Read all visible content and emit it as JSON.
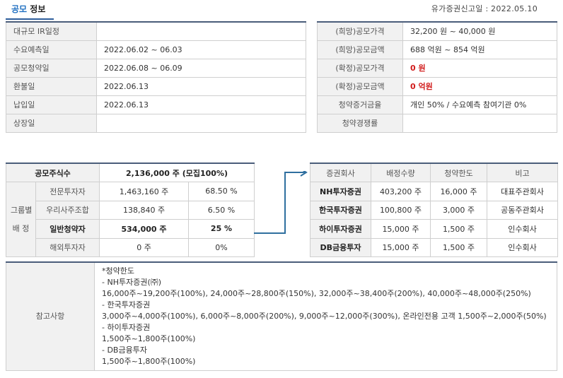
{
  "header": {
    "title_highlight": "공모",
    "title_rest": "정보",
    "report_date_label": "유가증권신고일 :",
    "report_date": "2022.05.10"
  },
  "schedule": [
    {
      "label": "대규모 IR일정",
      "value": ""
    },
    {
      "label": "수요예측일",
      "value": "2022.06.02 ~ 06.03"
    },
    {
      "label": "공모청약일",
      "value": "2022.06.08 ~ 06.09"
    },
    {
      "label": "환불일",
      "value": "2022.06.13"
    },
    {
      "label": "납입일",
      "value": "2022.06.13"
    },
    {
      "label": "상장일",
      "value": ""
    }
  ],
  "pricing": [
    {
      "label": "(희망)공모가격",
      "value": "32,200 원 ~ 40,000 원",
      "highlight": false
    },
    {
      "label": "(희망)공모금액",
      "value": "688 억원  ~ 854 억원",
      "highlight": false
    },
    {
      "label": "(확정)공모가격",
      "value": "0 원",
      "highlight": true
    },
    {
      "label": "(확정)공모금액",
      "value": "0 억원",
      "highlight": true
    },
    {
      "label": "청약증거금율",
      "value": "개인 50% / 수요예측 참여기관 0%",
      "highlight": false
    },
    {
      "label": "청약경쟁률",
      "value": "",
      "highlight": false
    }
  ],
  "allocation": {
    "total_label": "공모주식수",
    "total_value": "2,136,000 주 (모집100%)",
    "group_label_1": "그룹별",
    "group_label_2": "배 정",
    "rows": [
      {
        "label": "전문투자자",
        "shares": "1,463,160 주",
        "pct": "68.50 %",
        "bold": false
      },
      {
        "label": "우리사주조합",
        "shares": "138,840 주",
        "pct": "6.50 %",
        "bold": false
      },
      {
        "label": "일반청약자",
        "shares": "534,000 주",
        "pct": "25 %",
        "bold": true
      },
      {
        "label": "해외투자자",
        "shares": "0 주",
        "pct": "0%",
        "bold": false
      }
    ]
  },
  "brokers": {
    "headers": [
      "증권회사",
      "배정수량",
      "청약한도",
      "비고"
    ],
    "rows": [
      {
        "name": "NH투자증권",
        "qty": "403,200 주",
        "limit": "16,000 주",
        "note": "대표주관회사"
      },
      {
        "name": "한국투자증권",
        "qty": "100,800 주",
        "limit": "3,000 주",
        "note": "공동주관회사"
      },
      {
        "name": "하이투자증권",
        "qty": "15,000 주",
        "limit": "1,500 주",
        "note": "인수회사"
      },
      {
        "name": "DB금융투자",
        "qty": "15,000 주",
        "limit": "1,500 주",
        "note": "인수회사"
      }
    ]
  },
  "reference": {
    "label": "참고사항",
    "lines": [
      "*청약한도",
      "- NH투자증권(㈜)",
      "16,000주~19,200주(100%), 24,000주~28,800주(150%), 32,000주~38,400주(200%), 40,000주~48,000주(250%)",
      "- 한국투자증권",
      "3,000주~4,000주(100%), 6,000주~8,000주(200%), 9,000주~12,000주(300%), 온라인전용 고객 1,500주~2,000주(50%)",
      "- 하이투자증권",
      "1,500주~1,800주(100%)",
      "- DB금융투자",
      "1,500주~1,800주(100%)"
    ]
  }
}
